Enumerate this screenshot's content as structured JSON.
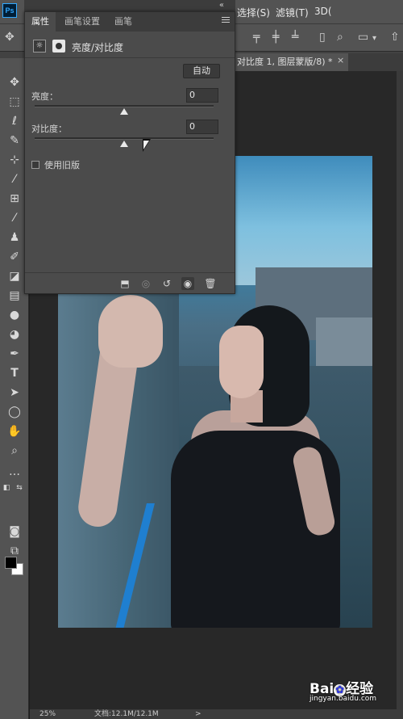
{
  "app": {
    "logo_text": "Ps",
    "menus": [
      "选择(S)",
      "滤镜(T)",
      "3D("
    ]
  },
  "document": {
    "tab_title": "对比度 1, 图层蒙版/8) *",
    "close_glyph": "×"
  },
  "panel": {
    "tabs": [
      "属性",
      "画笔设置",
      "画笔"
    ],
    "active_tab": "属性",
    "adjustment_title": "亮度/对比度",
    "auto_button": "自动",
    "brightness_label": "亮度：",
    "brightness_value": "0",
    "brightness_level": 0.5,
    "contrast_label": "对比度：",
    "contrast_value": "0",
    "contrast_level": 0.5,
    "legacy_checkbox_label": "使用旧版",
    "legacy_checked": false
  },
  "status": {
    "zoom": "25%",
    "doc_info": "文档:12.1M/12.1M",
    "arrow": ">"
  },
  "watermark": {
    "brand": "Bai",
    "brand_suffix": "经验",
    "url": "jingyan.baidu.com"
  },
  "colors": {
    "foreground": "#000000",
    "background": "#ffffff"
  },
  "tools": [
    "move-icon",
    "marquee-icon",
    "lasso-icon",
    "quick-select-icon",
    "crop-icon",
    "eyedropper-icon",
    "healing-icon",
    "brush-icon",
    "stamp-icon",
    "history-brush-icon",
    "eraser-icon",
    "gradient-icon",
    "blur-icon",
    "dodge-icon",
    "pen-icon",
    "type-icon",
    "path-select-icon",
    "shape-icon",
    "hand-icon",
    "zoom-icon",
    "more-icon"
  ]
}
